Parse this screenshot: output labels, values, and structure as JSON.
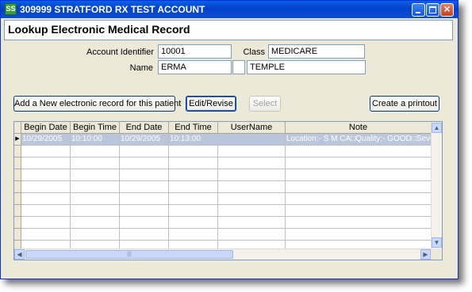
{
  "window": {
    "title": "309999 STRATFORD RX TEST ACCOUNT",
    "app_icon_text": "SS"
  },
  "header": {
    "title": "Lookup Electronic Medical Record"
  },
  "form": {
    "account_identifier_label": "Account Identifier",
    "account_identifier_value": "10001",
    "class_label": "Class",
    "class_value": "MEDICARE",
    "name_label": "Name",
    "first_name": "ERMA",
    "middle_initial": "",
    "last_name": "TEMPLE"
  },
  "toolbar": {
    "add_label": "Add a New electronic record for this patient",
    "edit_label": "Edit/Revise",
    "select_label": "Select",
    "print_label": "Create a printout"
  },
  "grid": {
    "columns": [
      "Begin Date",
      "Begin Time",
      "End Date",
      "End Time",
      "UserName",
      "Note"
    ],
    "rows": [
      [
        "10/29/2005",
        "10:10:00",
        "10/29/2005",
        "10:13:00",
        "",
        "Location:- S M CA□Quality:- GOOD□Seve"
      ]
    ],
    "row_indicator": "▶",
    "empty_rows": 10
  },
  "scrollbar": {
    "up_icon": "▲",
    "down_icon": "▼",
    "left_icon": "◀",
    "right_icon": "▶",
    "grip": "|||"
  },
  "colors": {
    "titlebar": "#0a5fe8",
    "window_bg": "#ece9d8",
    "selected_row": "#b9c6dd"
  }
}
